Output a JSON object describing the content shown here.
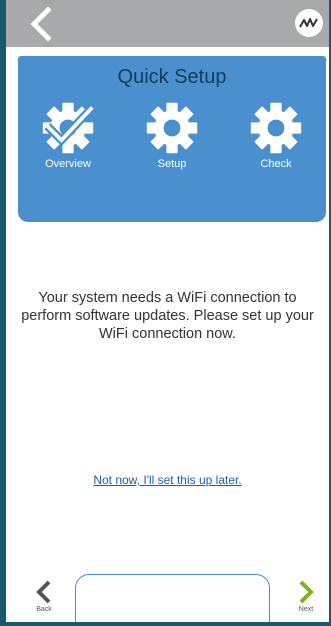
{
  "topbar": {
    "back_icon": "chevron-left-icon",
    "logo_icon": "brand-logo-icon"
  },
  "setup_panel": {
    "title": "Quick Setup",
    "steps": [
      {
        "label": "Overview",
        "icon": "gear-check-icon",
        "state": "complete"
      },
      {
        "label": "Setup",
        "icon": "gear-icon",
        "state": "pending"
      },
      {
        "label": "Check",
        "icon": "gear-icon",
        "state": "pending"
      }
    ],
    "panel_color": "#4a90cf"
  },
  "message": "Your system needs a WiFi connection to perform software updates. Please set up your WiFi connection now.",
  "later_link": "Not now, I'll set this up later.",
  "bottom_nav": {
    "back_label": "Back",
    "next_label": "Next",
    "next_color": "#7ab51d"
  }
}
